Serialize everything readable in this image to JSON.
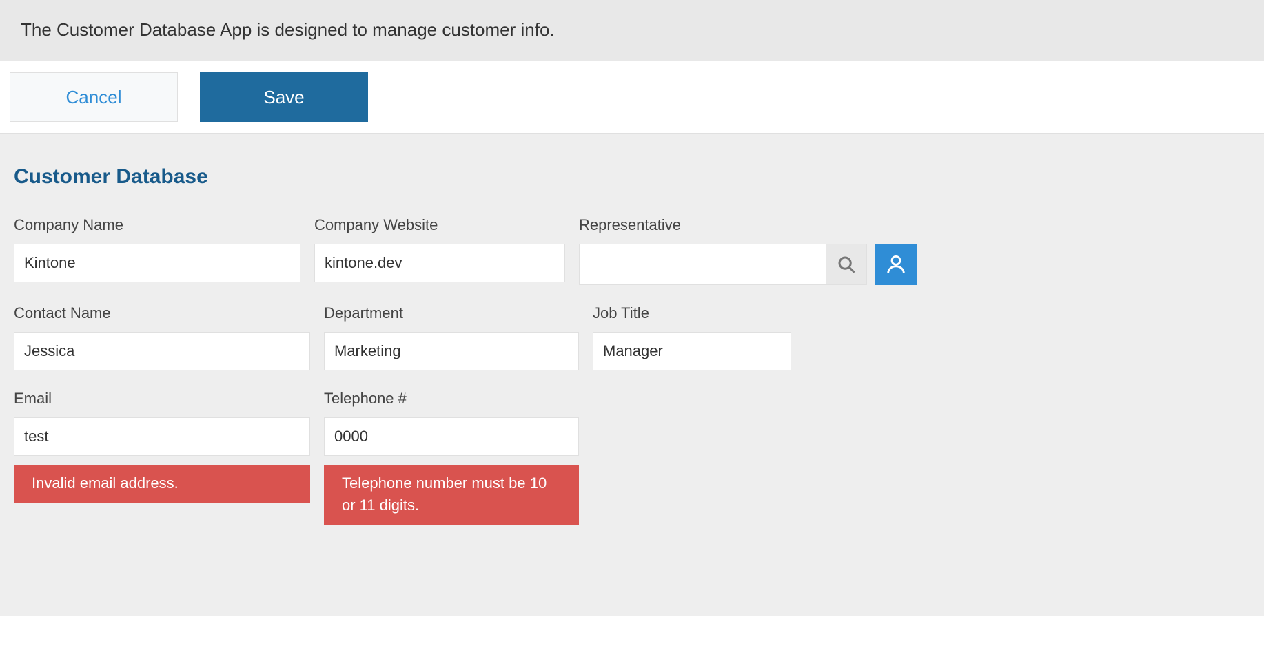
{
  "banner": {
    "description": "The Customer Database App is designed to manage customer info."
  },
  "toolbar": {
    "cancel_label": "Cancel",
    "save_label": "Save"
  },
  "form": {
    "title": "Customer Database",
    "fields": {
      "company_name": {
        "label": "Company Name",
        "value": "Kintone"
      },
      "company_website": {
        "label": "Company Website",
        "value": "kintone.dev"
      },
      "representative": {
        "label": "Representative",
        "value": ""
      },
      "contact_name": {
        "label": "Contact Name",
        "value": "Jessica"
      },
      "department": {
        "label": "Department",
        "value": "Marketing"
      },
      "job_title": {
        "label": "Job Title",
        "value": "Manager"
      },
      "email": {
        "label": "Email",
        "value": "test",
        "error": "Invalid email address."
      },
      "telephone": {
        "label": "Telephone #",
        "value": "0000",
        "error": "Telephone number must be 10 or 11 digits."
      }
    }
  },
  "icons": {
    "search": "search-icon",
    "user": "user-icon"
  }
}
